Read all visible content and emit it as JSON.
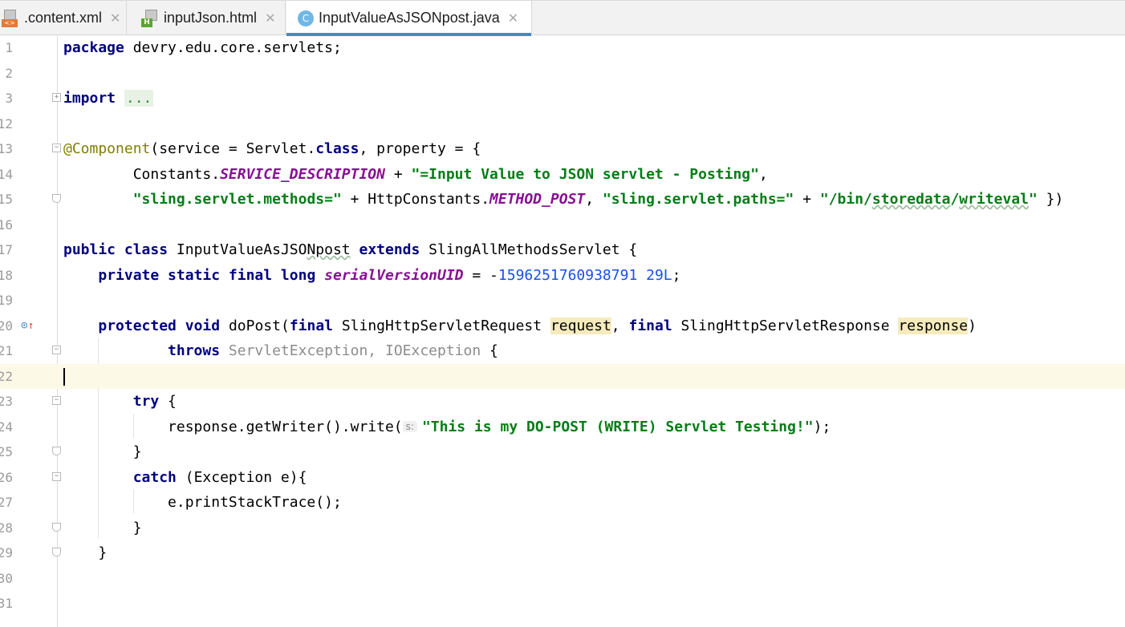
{
  "tabs": [
    {
      "label": ".content.xml",
      "icon": "xml-file-icon",
      "badge": "<>",
      "close": "✕"
    },
    {
      "label": "inputJson.html",
      "icon": "html-file-icon",
      "badge": "H",
      "close": "✕"
    },
    {
      "label": "InputValueAsJSONpost.java",
      "icon": "java-class-icon",
      "badge": "C",
      "close": "✕",
      "active": true
    }
  ],
  "lines": [
    {
      "n": "1"
    },
    {
      "n": "2"
    },
    {
      "n": "3"
    },
    {
      "n": "12"
    },
    {
      "n": "13"
    },
    {
      "n": "14"
    },
    {
      "n": "15"
    },
    {
      "n": "16"
    },
    {
      "n": "17"
    },
    {
      "n": "18"
    },
    {
      "n": "19"
    },
    {
      "n": "20"
    },
    {
      "n": "21"
    },
    {
      "n": "22"
    },
    {
      "n": "23"
    },
    {
      "n": "24"
    },
    {
      "n": "25"
    },
    {
      "n": "26"
    },
    {
      "n": "27"
    },
    {
      "n": "28"
    },
    {
      "n": "29"
    },
    {
      "n": "30"
    },
    {
      "n": "31"
    }
  ],
  "code": {
    "l1_kw": "package",
    "l1_rest": " devry.edu.core.servlets;",
    "l3_kw": "import",
    "l3_dots": "...",
    "l13_ann": "@Component",
    "l13_a": "(service = Servlet.",
    "l13_kw": "class",
    "l13_b": ", property = {",
    "l14_a": "        Constants.",
    "l14_const": "SERVICE_DESCRIPTION",
    "l14_b": " + ",
    "l14_str": "\"=Input Value to JSON servlet - Posting\"",
    "l14_c": ",",
    "l15_indent": "        ",
    "l15_str1": "\"sling.servlet.methods=\"",
    "l15_a": " + HttpConstants.",
    "l15_const": "METHOD_POST",
    "l15_b": ", ",
    "l15_str2": "\"sling.servlet.paths=\"",
    "l15_c": " + ",
    "l15_str3a": "\"/bin/",
    "l15_str3b": "storedata",
    "l15_str3c": "/",
    "l15_str3d": "writeval",
    "l15_str3e": "\"",
    "l15_d": " })",
    "l17_kw1": "public",
    "l17_kw2": "class",
    "l17_a": " InputValueAsJSO",
    "l17_sq": "Npost",
    "l17_kw3": "extends",
    "l17_b": " SlingAllMethodsServlet {",
    "l18_indent": "    ",
    "l18_kw": "private static final long",
    "l18_const": "serialVersionUID",
    "l18_a": " = -",
    "l18_num": "1596251760938791 29L",
    "l18_b": ";",
    "l20_indent": "    ",
    "l20_kw1": "protected",
    "l20_kw2": "void",
    "l20_a": " doPost(",
    "l20_kw3": "final",
    "l20_b": " SlingHttpServletRequest ",
    "l20_p1": "request",
    "l20_c": ", ",
    "l20_kw4": "final",
    "l20_d": " SlingHttpServletResponse ",
    "l20_p2": "response",
    "l20_e": ")",
    "l21_indent": "            ",
    "l21_kw": "throws",
    "l21_gray": " ServletException, IOException",
    "l21_a": " {",
    "l23_indent": "        ",
    "l23_kw": "try",
    "l23_a": " {",
    "l24_indent": "            ",
    "l24_a": "response.getWriter().write(",
    "l24_hint": "s:",
    "l24_str": "\"This is my DO-POST (WRITE) Servlet Testing!\"",
    "l24_b": ");",
    "l25": "        }",
    "l26_indent": "        ",
    "l26_kw": "catch",
    "l26_a": " (Exception e){",
    "l27": "            e.printStackTrace();",
    "l28": "        }",
    "l29": "    }"
  },
  "colors": {
    "keyword": "#000080",
    "string": "#067d17",
    "number": "#1750eb",
    "annotation": "#808000",
    "constant": "#871094",
    "active_tab_underline": "#4a86c8",
    "current_line": "#fdf9e7"
  },
  "gutter_icons": {
    "l20": "override-method-icon"
  }
}
